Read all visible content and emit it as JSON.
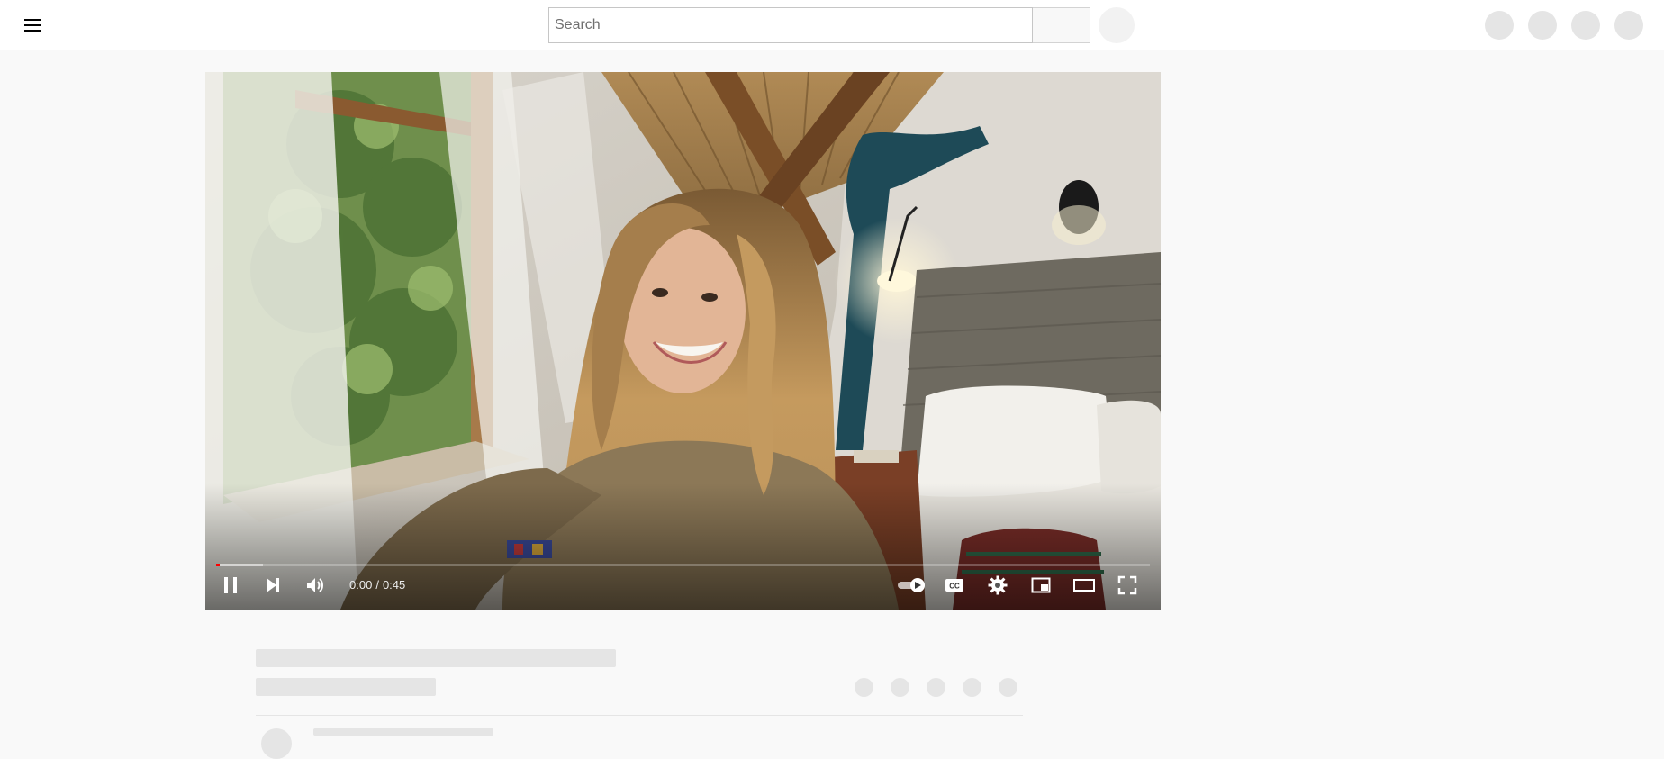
{
  "header": {
    "search": {
      "placeholder": "Search",
      "value": ""
    }
  },
  "player": {
    "current_time": "0:00",
    "separator": "/",
    "duration": "0:45",
    "progress": {
      "played_fraction": 0.004,
      "buffered_fraction": 0.05
    },
    "autoplay": "on",
    "accent_color": "#ff0000"
  },
  "icons": {
    "menu": "hamburger-menu-icon",
    "play_pause": "pause-icon",
    "next": "skip-next-icon",
    "volume": "volume-icon",
    "autoplay": "autoplay-toggle-icon",
    "captions": "closed-captions-icon",
    "settings": "gear-icon",
    "miniplayer": "miniplayer-icon",
    "theater": "theater-mode-icon",
    "fullscreen": "fullscreen-icon"
  }
}
